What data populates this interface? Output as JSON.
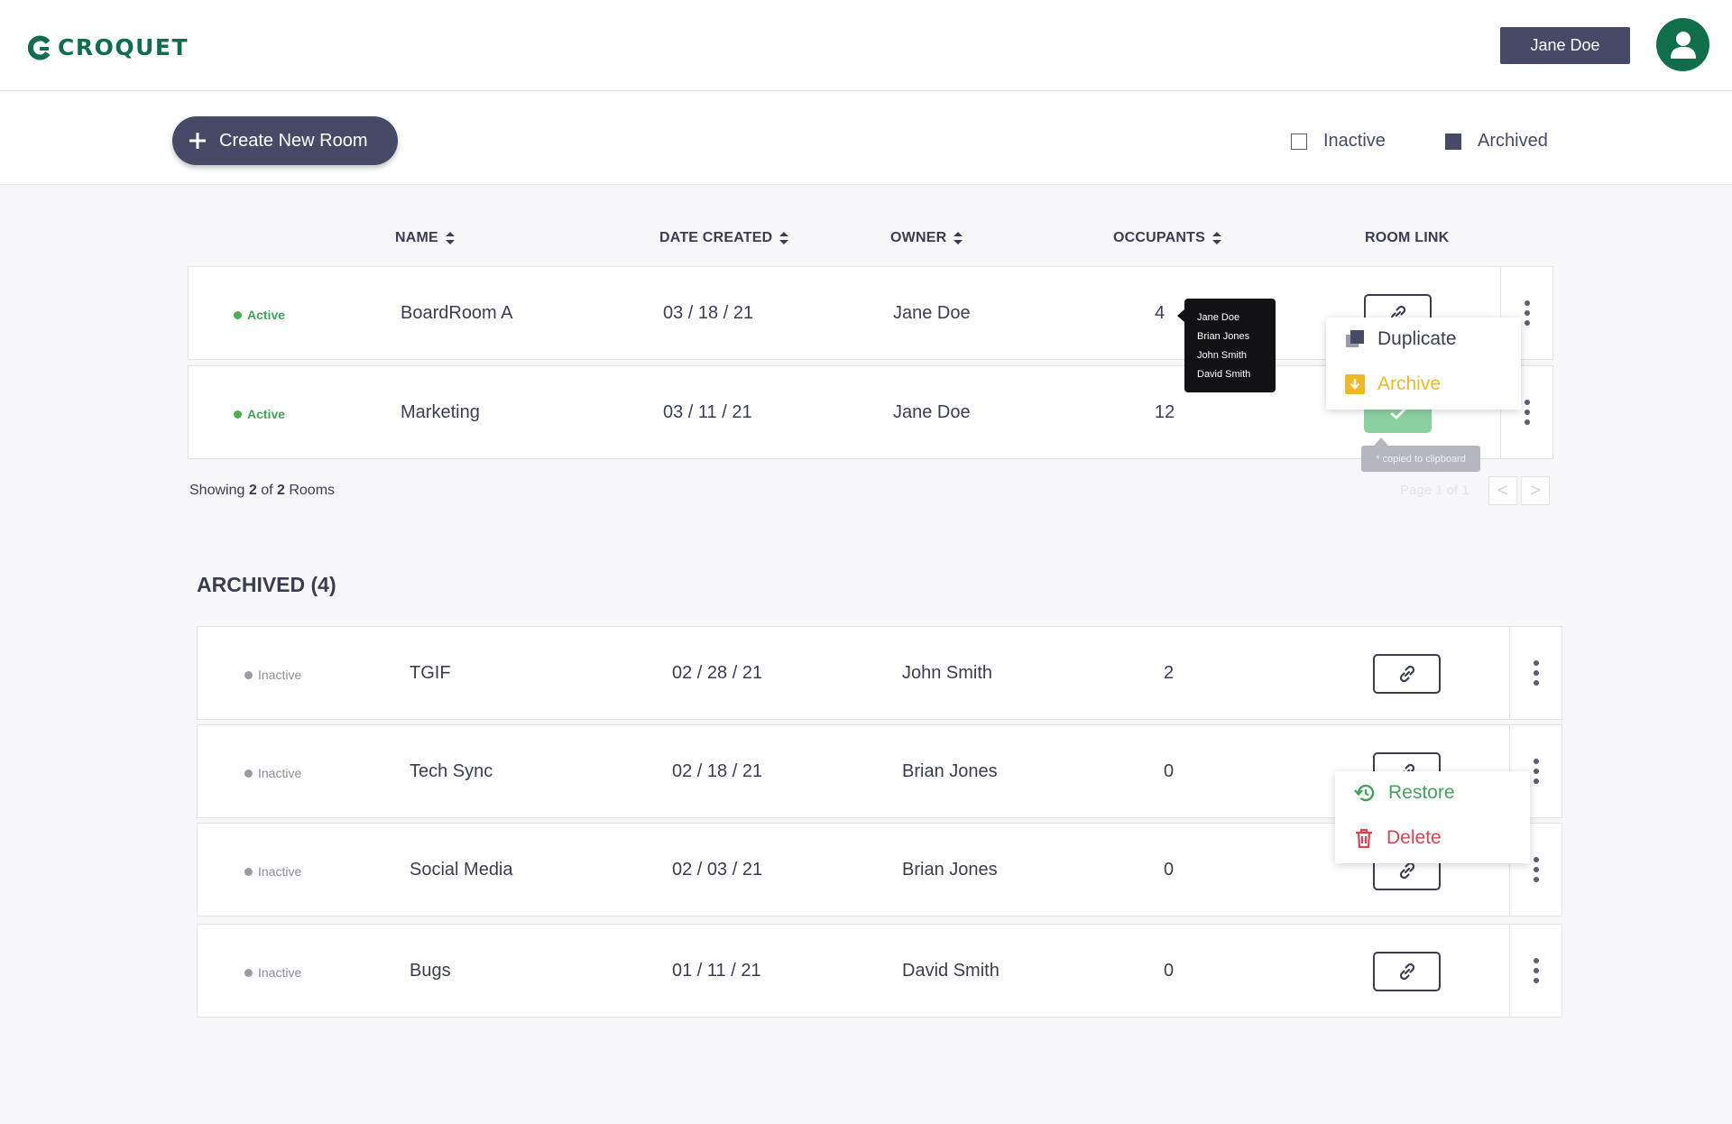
{
  "header": {
    "logo_text": "CROQUET",
    "user_name": "Jane Doe",
    "brand_color": "#0e6f4a"
  },
  "toolbar": {
    "create_label": "Create New Room",
    "filters": [
      {
        "label": "Inactive",
        "checked": false
      },
      {
        "label": "Archived",
        "checked": true
      }
    ]
  },
  "table": {
    "columns": [
      "NAME",
      "DATE CREATED",
      "OWNER",
      "OCCUPANTS",
      "ROOM LINK"
    ]
  },
  "active_rooms": [
    {
      "status": "Active",
      "name": "BoardRoom A",
      "date": "03 / 18 / 21",
      "owner": "Jane Doe",
      "occupants": "4"
    },
    {
      "status": "Active",
      "name": "Marketing",
      "date": "03 / 11 / 21",
      "owner": "Jane Doe",
      "occupants": "12"
    }
  ],
  "showing": {
    "prefix": "Showing",
    "count": "2",
    "of": "of",
    "total": "2",
    "suffix": "Rooms"
  },
  "pager": {
    "text": "Page 1 of 1",
    "prev": "<",
    "next": ">"
  },
  "occupants_tooltip": [
    "Jane Doe",
    "Brian Jones",
    "John Smith",
    "David Smith"
  ],
  "active_menu": {
    "duplicate": "Duplicate",
    "archive": "Archive"
  },
  "copied_tip": "* copied to clipboard",
  "archived": {
    "title": "ARCHIVED (4)",
    "rooms": [
      {
        "status": "Inactive",
        "name": "TGIF",
        "date": "02 / 28 / 21",
        "owner": "John Smith",
        "occupants": "2"
      },
      {
        "status": "Inactive",
        "name": "Tech Sync",
        "date": "02 / 18 / 21",
        "owner": "Brian Jones",
        "occupants": "0"
      },
      {
        "status": "Inactive",
        "name": "Social Media",
        "date": "02 / 03 / 21",
        "owner": "Brian Jones",
        "occupants": "0"
      },
      {
        "status": "Inactive",
        "name": "Bugs",
        "date": "01 / 11 / 21",
        "owner": "David Smith",
        "occupants": "0"
      }
    ]
  },
  "archived_menu": {
    "restore": "Restore",
    "delete": "Delete"
  },
  "colors": {
    "archive": "#f2b824",
    "restore": "#3fa55b",
    "delete": "#e0414f"
  }
}
